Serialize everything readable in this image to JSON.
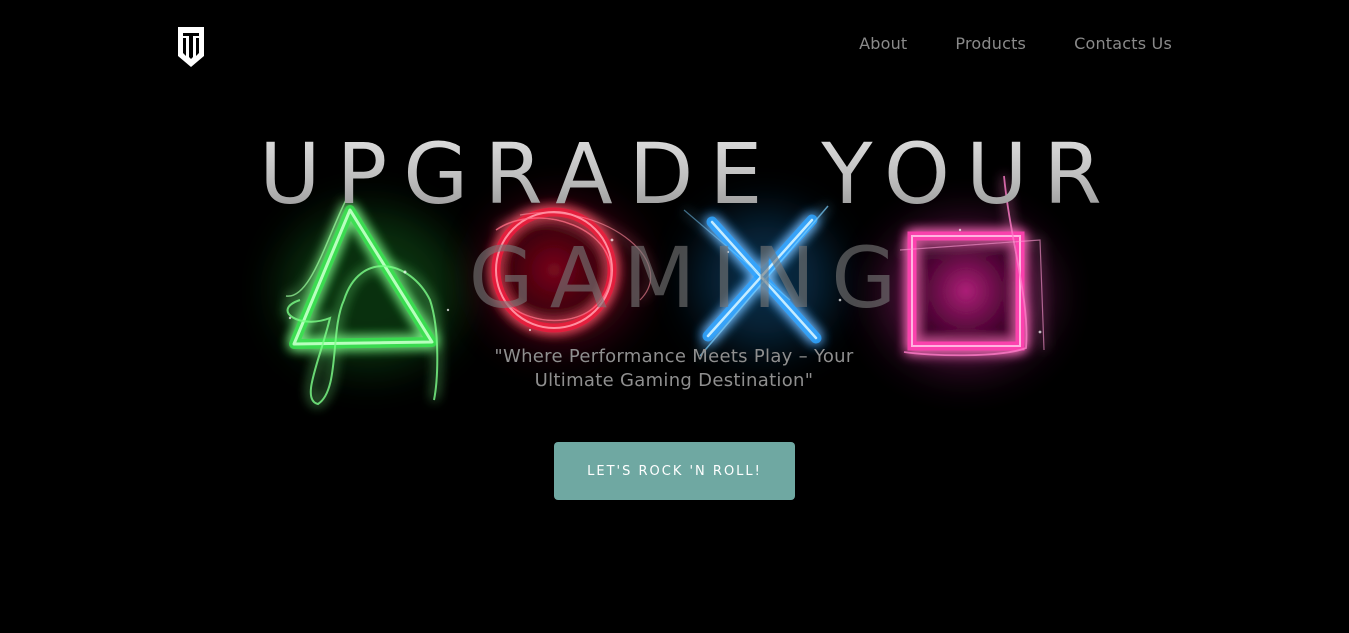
{
  "header": {
    "logo_icon": "shield-logo-icon",
    "nav": [
      {
        "label": "About"
      },
      {
        "label": "Products"
      },
      {
        "label": "Contacts Us"
      }
    ]
  },
  "hero": {
    "headline_line1": "UPGRADE YOUR",
    "headline_line2": "GAMING",
    "tagline": "\"Where Performance Meets Play – Your Ultimate Gaming Destination\"",
    "cta_label": "LET'S ROCK 'N ROLL!",
    "background_art": [
      "triangle-neon-icon",
      "circle-neon-icon",
      "cross-neon-icon",
      "square-neon-icon"
    ]
  },
  "colors": {
    "background": "#000000",
    "nav_text": "#8a8a8a",
    "cta_background": "#6fa8a2",
    "neon_green": "#2fe04a",
    "neon_red": "#e8193a",
    "neon_blue": "#29a3ff",
    "neon_pink": "#ff3fb0"
  }
}
